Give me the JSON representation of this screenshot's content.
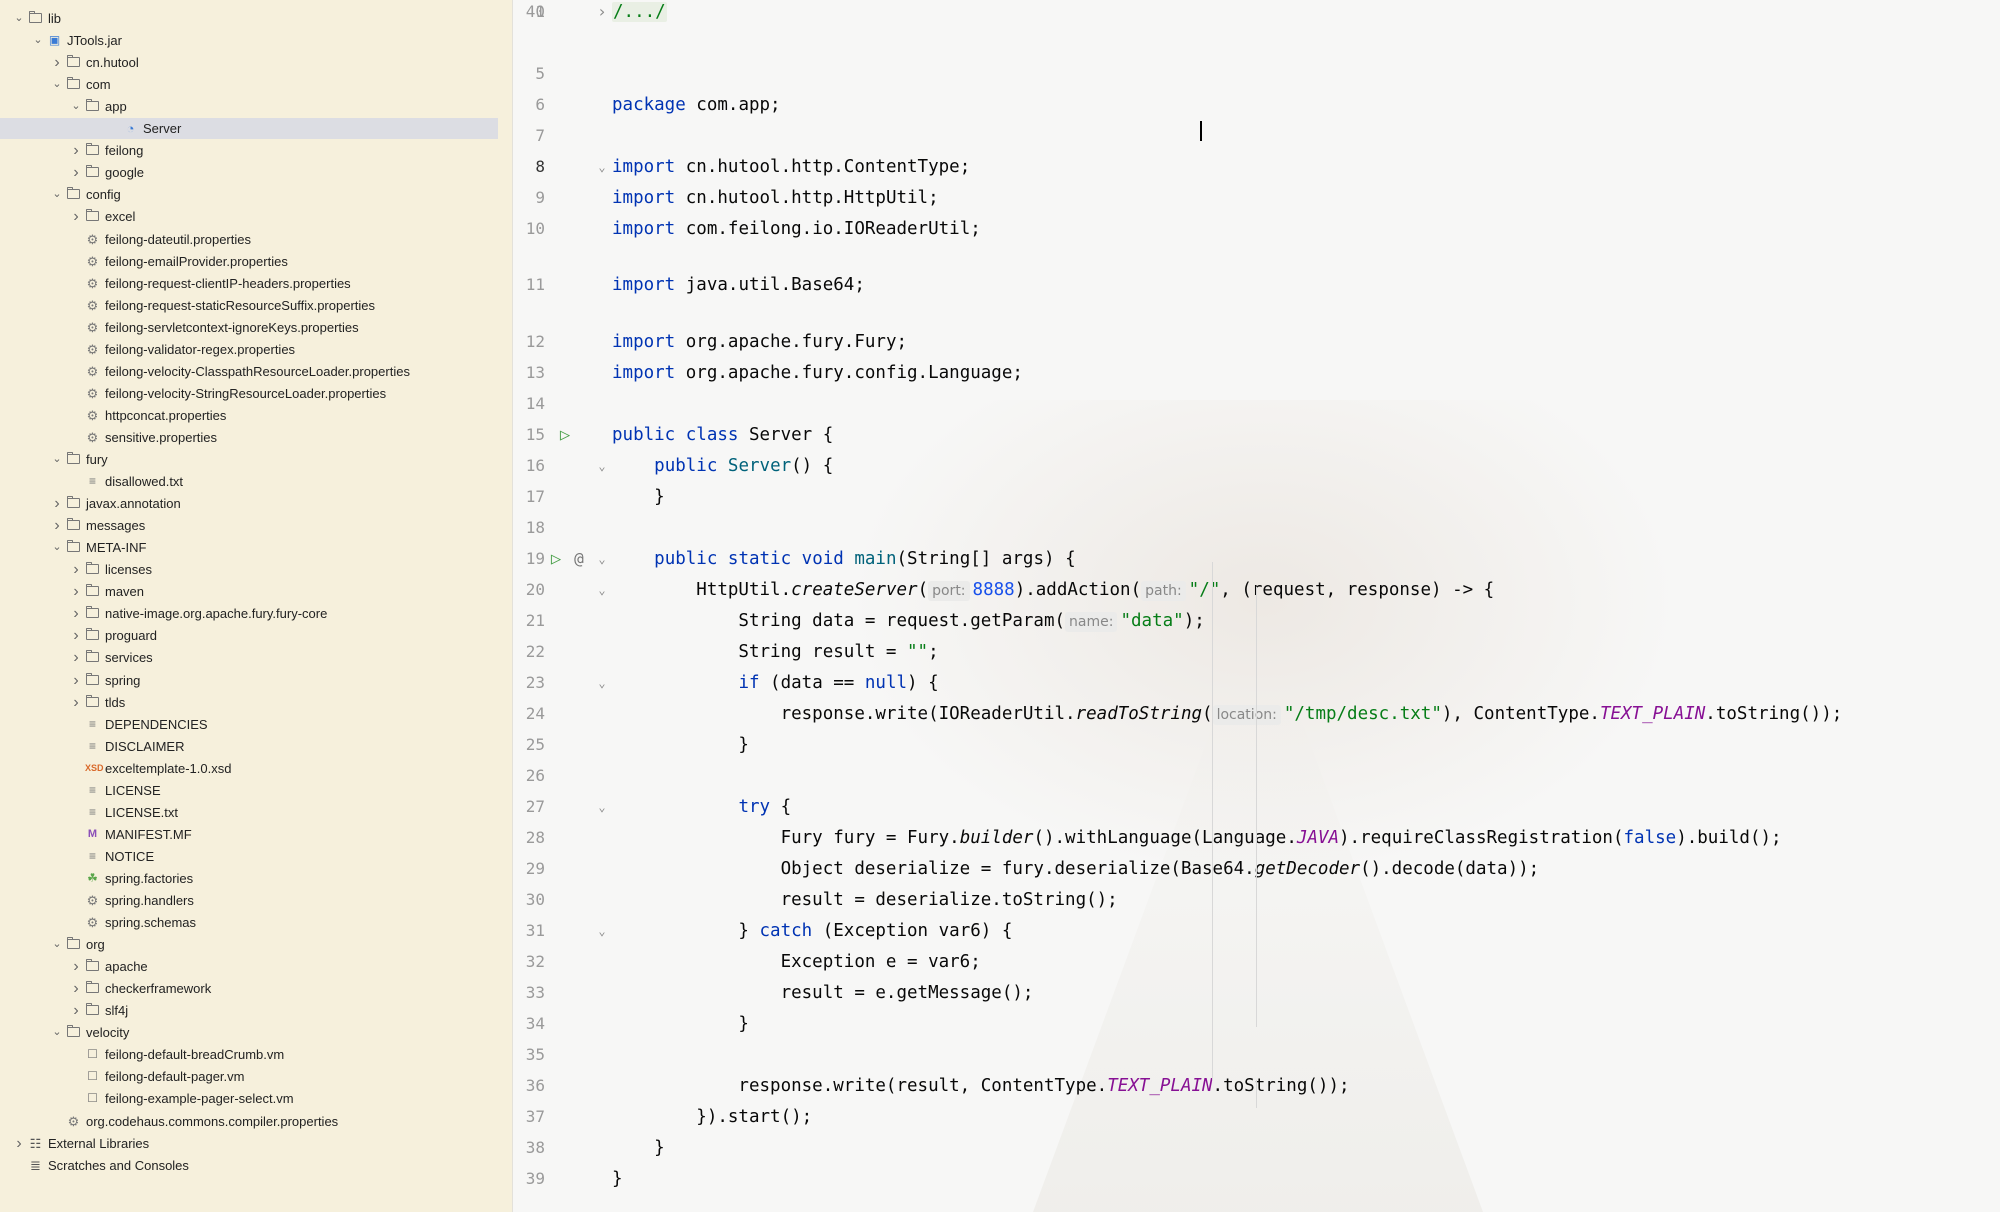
{
  "sidebar": {
    "tree": [
      {
        "label": "lib",
        "depth": 0,
        "chev": "v",
        "icon": "folder-icon"
      },
      {
        "label": "JTools.jar",
        "depth": 1,
        "chev": "v",
        "icon": "jar-icon"
      },
      {
        "label": "cn.hutool",
        "depth": 2,
        "chev": ">",
        "icon": "folder-icon"
      },
      {
        "label": "com",
        "depth": 2,
        "chev": "v",
        "icon": "folder-icon"
      },
      {
        "label": "app",
        "depth": 3,
        "chev": "v",
        "icon": "folder-icon"
      },
      {
        "label": "Server",
        "depth": 5,
        "chev": "",
        "icon": "class-icon",
        "selected": true
      },
      {
        "label": "feilong",
        "depth": 3,
        "chev": ">",
        "icon": "folder-icon"
      },
      {
        "label": "google",
        "depth": 3,
        "chev": ">",
        "icon": "folder-icon"
      },
      {
        "label": "config",
        "depth": 2,
        "chev": "v",
        "icon": "folder-icon"
      },
      {
        "label": "excel",
        "depth": 3,
        "chev": ">",
        "icon": "folder-icon"
      },
      {
        "label": "feilong-dateutil.properties",
        "depth": 3,
        "chev": "",
        "icon": "gear-icon"
      },
      {
        "label": "feilong-emailProvider.properties",
        "depth": 3,
        "chev": "",
        "icon": "gear-icon"
      },
      {
        "label": "feilong-request-clientIP-headers.properties",
        "depth": 3,
        "chev": "",
        "icon": "gear-icon"
      },
      {
        "label": "feilong-request-staticResourceSuffix.properties",
        "depth": 3,
        "chev": "",
        "icon": "gear-icon"
      },
      {
        "label": "feilong-servletcontext-ignoreKeys.properties",
        "depth": 3,
        "chev": "",
        "icon": "gear-icon"
      },
      {
        "label": "feilong-validator-regex.properties",
        "depth": 3,
        "chev": "",
        "icon": "gear-icon"
      },
      {
        "label": "feilong-velocity-ClasspathResourceLoader.properties",
        "depth": 3,
        "chev": "",
        "icon": "gear-icon"
      },
      {
        "label": "feilong-velocity-StringResourceLoader.properties",
        "depth": 3,
        "chev": "",
        "icon": "gear-icon"
      },
      {
        "label": "httpconcat.properties",
        "depth": 3,
        "chev": "",
        "icon": "gear-icon"
      },
      {
        "label": "sensitive.properties",
        "depth": 3,
        "chev": "",
        "icon": "gear-icon"
      },
      {
        "label": "fury",
        "depth": 2,
        "chev": "v",
        "icon": "folder-icon"
      },
      {
        "label": "disallowed.txt",
        "depth": 3,
        "chev": "",
        "icon": "text-file-icon"
      },
      {
        "label": "javax.annotation",
        "depth": 2,
        "chev": ">",
        "icon": "folder-icon"
      },
      {
        "label": "messages",
        "depth": 2,
        "chev": ">",
        "icon": "folder-icon"
      },
      {
        "label": "META-INF",
        "depth": 2,
        "chev": "v",
        "icon": "folder-icon"
      },
      {
        "label": "licenses",
        "depth": 3,
        "chev": ">",
        "icon": "folder-icon"
      },
      {
        "label": "maven",
        "depth": 3,
        "chev": ">",
        "icon": "folder-icon"
      },
      {
        "label": "native-image.org.apache.fury.fury-core",
        "depth": 3,
        "chev": ">",
        "icon": "folder-icon"
      },
      {
        "label": "proguard",
        "depth": 3,
        "chev": ">",
        "icon": "folder-icon"
      },
      {
        "label": "services",
        "depth": 3,
        "chev": ">",
        "icon": "folder-icon"
      },
      {
        "label": "spring",
        "depth": 3,
        "chev": ">",
        "icon": "folder-icon"
      },
      {
        "label": "tlds",
        "depth": 3,
        "chev": ">",
        "icon": "folder-icon"
      },
      {
        "label": "DEPENDENCIES",
        "depth": 3,
        "chev": "",
        "icon": "text-file-icon"
      },
      {
        "label": "DISCLAIMER",
        "depth": 3,
        "chev": "",
        "icon": "text-file-icon"
      },
      {
        "label": "exceltemplate-1.0.xsd",
        "depth": 3,
        "chev": "",
        "icon": "xsd-file-icon"
      },
      {
        "label": "LICENSE",
        "depth": 3,
        "chev": "",
        "icon": "text-file-icon"
      },
      {
        "label": "LICENSE.txt",
        "depth": 3,
        "chev": "",
        "icon": "text-file-icon"
      },
      {
        "label": "MANIFEST.MF",
        "depth": 3,
        "chev": "",
        "icon": "manifest-file-icon"
      },
      {
        "label": "NOTICE",
        "depth": 3,
        "chev": "",
        "icon": "text-file-icon"
      },
      {
        "label": "spring.factories",
        "depth": 3,
        "chev": "",
        "icon": "spring-file-icon"
      },
      {
        "label": "spring.handlers",
        "depth": 3,
        "chev": "",
        "icon": "gear-icon"
      },
      {
        "label": "spring.schemas",
        "depth": 3,
        "chev": "",
        "icon": "gear-icon"
      },
      {
        "label": "org",
        "depth": 2,
        "chev": "v",
        "icon": "folder-icon"
      },
      {
        "label": "apache",
        "depth": 3,
        "chev": ">",
        "icon": "folder-icon"
      },
      {
        "label": "checkerframework",
        "depth": 3,
        "chev": ">",
        "icon": "folder-icon"
      },
      {
        "label": "slf4j",
        "depth": 3,
        "chev": ">",
        "icon": "folder-icon"
      },
      {
        "label": "velocity",
        "depth": 2,
        "chev": "v",
        "icon": "folder-icon"
      },
      {
        "label": "feilong-default-breadCrumb.vm",
        "depth": 3,
        "chev": "",
        "icon": "vm-file-icon"
      },
      {
        "label": "feilong-default-pager.vm",
        "depth": 3,
        "chev": "",
        "icon": "vm-file-icon"
      },
      {
        "label": "feilong-example-pager-select.vm",
        "depth": 3,
        "chev": "",
        "icon": "vm-file-icon"
      },
      {
        "label": "org.codehaus.commons.compiler.properties",
        "depth": 2,
        "chev": "",
        "icon": "gear-icon"
      },
      {
        "label": "External Libraries",
        "depth": 0,
        "chev": ">",
        "icon": "library-icon",
        "plain": true
      },
      {
        "label": "Scratches and Consoles",
        "depth": 0,
        "chev": "",
        "icon": "scratches-icon",
        "plain": true
      }
    ]
  },
  "editor": {
    "lines": [
      {
        "n": "1",
        "tokens": [
          [
            "collapsed",
            "/.../"
          ]
        ],
        "fold": ">"
      },
      {
        "n": "5",
        "tokens": []
      },
      {
        "n": "6",
        "tokens": [
          [
            "kw",
            "package"
          ],
          [
            "",
            "com.app;"
          ]
        ]
      },
      {
        "n": "7",
        "tokens": []
      },
      {
        "n": "8",
        "tokens": [
          [
            "kw",
            "import"
          ],
          [
            "",
            "cn.hutool.http.ContentType;"
          ]
        ],
        "fold": "v",
        "current": true
      },
      {
        "n": "9",
        "tokens": [
          [
            "kw",
            "import"
          ],
          [
            "",
            "cn.hutool.http.HttpUtil;"
          ]
        ]
      },
      {
        "n": "10",
        "tokens": [
          [
            "kw",
            "import"
          ],
          [
            "",
            "com.feilong.io.IOReaderUtil;"
          ]
        ]
      },
      {
        "n": "11",
        "tokens": [
          [
            "kw",
            "import"
          ],
          [
            "",
            "java.util.Base64;"
          ]
        ]
      },
      {
        "n": "12",
        "tokens": [
          [
            "kw",
            "import"
          ],
          [
            "",
            "org.apache.fury.Fury;"
          ]
        ]
      },
      {
        "n": "13",
        "tokens": [
          [
            "kw",
            "import"
          ],
          [
            "",
            "org.apache.fury.config.Language;"
          ]
        ]
      },
      {
        "n": "14",
        "tokens": []
      },
      {
        "n": "15",
        "tokens": [
          [
            "kw",
            "public class"
          ],
          [
            "",
            "Server {"
          ]
        ],
        "run": true
      },
      {
        "n": "16",
        "tokens": [
          [
            "",
            "    "
          ],
          [
            "kw",
            "public"
          ],
          [
            "fn",
            "Server"
          ],
          [
            "",
            "() {"
          ]
        ],
        "fold": "v"
      },
      {
        "n": "17",
        "tokens": [
          [
            "",
            "    }"
          ]
        ]
      },
      {
        "n": "18",
        "tokens": []
      },
      {
        "n": "19",
        "tokens": [
          [
            "",
            "    "
          ],
          [
            "kw",
            "public static void"
          ],
          [
            "fn",
            "main"
          ],
          [
            "",
            "(String[] args) {"
          ]
        ],
        "fold": "v",
        "run": true,
        "at": true
      },
      {
        "n": "20",
        "tokens": [
          [
            "",
            "        HttpUtil."
          ],
          [
            "it",
            "createServer"
          ],
          [
            "",
            "("
          ],
          [
            "hint",
            "port:"
          ],
          [
            "num",
            "8888"
          ],
          [
            "",
            ").addAction("
          ],
          [
            "hint",
            "path:"
          ],
          [
            "str",
            "\"/\""
          ],
          [
            "",
            ", (request, response) -> {"
          ]
        ],
        "fold": "v"
      },
      {
        "n": "21",
        "tokens": [
          [
            "",
            "            String data = request.getParam("
          ],
          [
            "hint",
            "name:"
          ],
          [
            "str",
            "\"data\""
          ],
          [
            "",
            ");"
          ]
        ]
      },
      {
        "n": "22",
        "tokens": [
          [
            "",
            "            String result = "
          ],
          [
            "str",
            "\"\""
          ],
          [
            "",
            ";"
          ]
        ]
      },
      {
        "n": "23",
        "tokens": [
          [
            "",
            "            "
          ],
          [
            "kw",
            "if"
          ],
          [
            "",
            " (data == "
          ],
          [
            "kw",
            "null"
          ],
          [
            "",
            ") {"
          ]
        ],
        "fold": "v"
      },
      {
        "n": "24",
        "tokens": [
          [
            "",
            "                response.write(IOReaderUtil."
          ],
          [
            "it",
            "readToString"
          ],
          [
            "",
            "("
          ],
          [
            "hint",
            "location:"
          ],
          [
            "str",
            "\"/tmp/desc.txt\""
          ],
          [
            "",
            "), ContentType."
          ],
          [
            "const",
            "TEXT_PLAIN"
          ],
          [
            "",
            ".toString());"
          ]
        ]
      },
      {
        "n": "25",
        "tokens": [
          [
            "",
            "            }"
          ]
        ]
      },
      {
        "n": "26",
        "tokens": []
      },
      {
        "n": "27",
        "tokens": [
          [
            "",
            "            "
          ],
          [
            "kw",
            "try"
          ],
          [
            "",
            " {"
          ]
        ],
        "fold": "v"
      },
      {
        "n": "28",
        "tokens": [
          [
            "",
            "                Fury fury = Fury."
          ],
          [
            "it",
            "builder"
          ],
          [
            "",
            "().withLanguage(Language."
          ],
          [
            "const",
            "JAVA"
          ],
          [
            "",
            ").requireClassRegistration("
          ],
          [
            "kw",
            "false"
          ],
          [
            "",
            ").build();"
          ]
        ]
      },
      {
        "n": "29",
        "tokens": [
          [
            "",
            "                Object deserialize = fury.deserialize(Base64."
          ],
          [
            "it",
            "getDecoder"
          ],
          [
            "",
            "().decode(data));"
          ]
        ]
      },
      {
        "n": "30",
        "tokens": [
          [
            "",
            "                result = deserialize.toString();"
          ]
        ]
      },
      {
        "n": "31",
        "tokens": [
          [
            "",
            "            } "
          ],
          [
            "kw",
            "catch"
          ],
          [
            "",
            " (Exception var6) {"
          ]
        ],
        "fold": "v"
      },
      {
        "n": "32",
        "tokens": [
          [
            "",
            "                Exception e = var6;"
          ]
        ]
      },
      {
        "n": "33",
        "tokens": [
          [
            "",
            "                result = e.getMessage();"
          ]
        ]
      },
      {
        "n": "34",
        "tokens": [
          [
            "",
            "            }"
          ]
        ]
      },
      {
        "n": "35",
        "tokens": []
      },
      {
        "n": "36",
        "tokens": [
          [
            "",
            "            response.write(result, ContentType."
          ],
          [
            "const",
            "TEXT_PLAIN"
          ],
          [
            "",
            ".toString());"
          ]
        ]
      },
      {
        "n": "37",
        "tokens": [
          [
            "",
            "        }).start();"
          ]
        ]
      },
      {
        "n": "38",
        "tokens": [
          [
            "",
            "    }"
          ]
        ]
      },
      {
        "n": "39",
        "tokens": [
          [
            "",
            "}"
          ]
        ]
      },
      {
        "n": "40",
        "tokens": []
      }
    ]
  }
}
